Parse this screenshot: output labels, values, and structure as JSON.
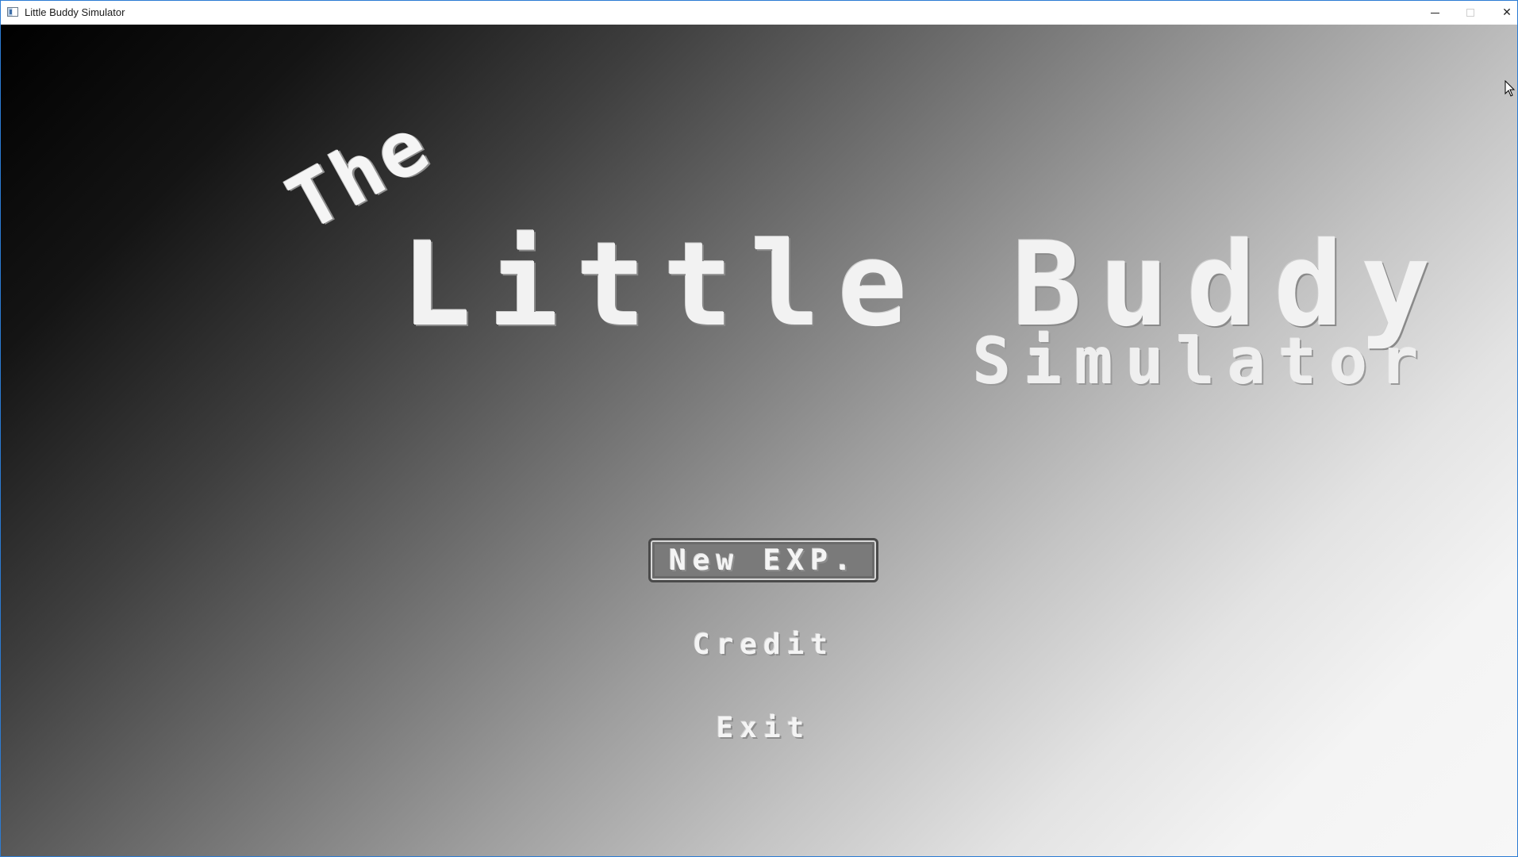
{
  "window": {
    "title": "Little Buddy Simulator",
    "controls": {
      "minimize": "minimize",
      "maximize": "maximize",
      "close": "✕"
    }
  },
  "game": {
    "title": {
      "the": "The",
      "main": "Little Buddy",
      "sub": "Simulator"
    },
    "menu": {
      "new_exp": "New EXP.",
      "credit": "Credit",
      "exit": "Exit"
    },
    "selected_item": "New EXP."
  },
  "colors": {
    "background_dark": "#000000",
    "background_light": "#f7f7f7",
    "text": "#f3f3f3",
    "button_fill": "#7a7a7a",
    "window_border": "#2b7bd3"
  }
}
